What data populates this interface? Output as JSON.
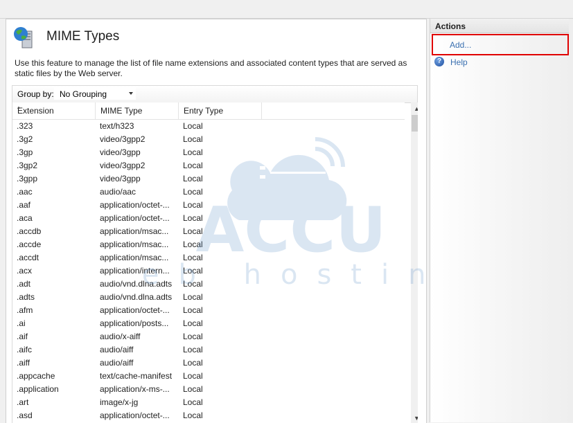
{
  "main": {
    "title": "MIME Types",
    "description": "Use this feature to manage the list of file name extensions and associated content types that are served as static files by the Web server.",
    "group_by_label": "Group by:",
    "group_by_value": "No Grouping"
  },
  "columns": [
    "Extension",
    "MIME Type",
    "Entry Type"
  ],
  "rows": [
    [
      ".323",
      "text/h323",
      "Local"
    ],
    [
      ".3g2",
      "video/3gpp2",
      "Local"
    ],
    [
      ".3gp",
      "video/3gpp",
      "Local"
    ],
    [
      ".3gp2",
      "video/3gpp2",
      "Local"
    ],
    [
      ".3gpp",
      "video/3gpp",
      "Local"
    ],
    [
      ".aac",
      "audio/aac",
      "Local"
    ],
    [
      ".aaf",
      "application/octet-...",
      "Local"
    ],
    [
      ".aca",
      "application/octet-...",
      "Local"
    ],
    [
      ".accdb",
      "application/msac...",
      "Local"
    ],
    [
      ".accde",
      "application/msac...",
      "Local"
    ],
    [
      ".accdt",
      "application/msac...",
      "Local"
    ],
    [
      ".acx",
      "application/intern...",
      "Local"
    ],
    [
      ".adt",
      "audio/vnd.dlna.adts",
      "Local"
    ],
    [
      ".adts",
      "audio/vnd.dlna.adts",
      "Local"
    ],
    [
      ".afm",
      "application/octet-...",
      "Local"
    ],
    [
      ".ai",
      "application/posts...",
      "Local"
    ],
    [
      ".aif",
      "audio/x-aiff",
      "Local"
    ],
    [
      ".aifc",
      "audio/aiff",
      "Local"
    ],
    [
      ".aiff",
      "audio/aiff",
      "Local"
    ],
    [
      ".appcache",
      "text/cache-manifest",
      "Local"
    ],
    [
      ".application",
      "application/x-ms-...",
      "Local"
    ],
    [
      ".art",
      "image/x-jg",
      "Local"
    ],
    [
      ".asd",
      "application/octet-...",
      "Local"
    ]
  ],
  "actions": {
    "header": "Actions",
    "add_label": "Add...",
    "help_label": "Help"
  },
  "watermark": {
    "brand": "ACCU",
    "tagline": "web hosting"
  },
  "colors": {
    "link": "#3a70b0",
    "highlight_box": "#e00000",
    "watermark": "#5b8fc9"
  }
}
